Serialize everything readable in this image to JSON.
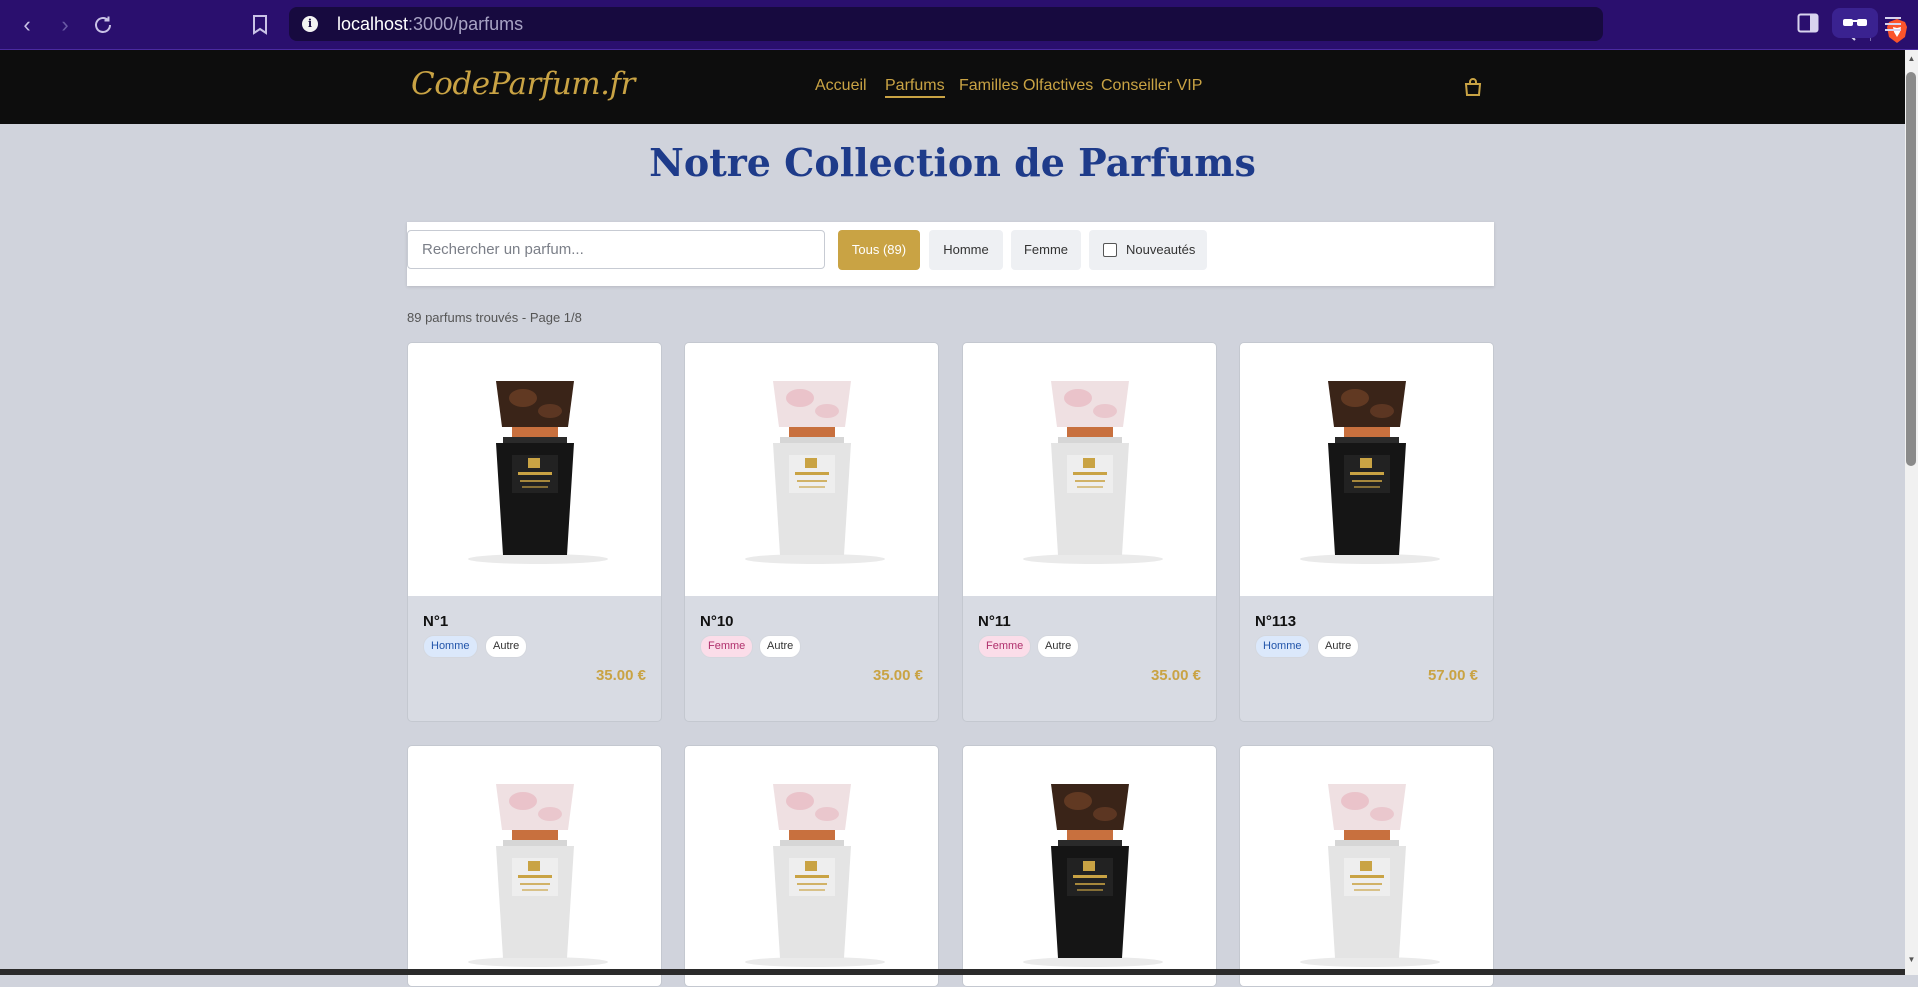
{
  "browser": {
    "url_host": "localhost",
    "url_path": ":3000/parfums",
    "info_icon": "info-icon"
  },
  "site": {
    "logo": "CodeParfum.fr",
    "nav": [
      {
        "label": "Accueil",
        "active": false
      },
      {
        "label": "Parfums",
        "active": true
      },
      {
        "label": "Familles Olfactives",
        "active": false
      },
      {
        "label": "Conseiller VIP",
        "active": false
      }
    ],
    "cart_icon": "shopping-bag-icon"
  },
  "main": {
    "title": "Notre Collection de Parfums",
    "search_placeholder": "Rechercher un parfum...",
    "filters": {
      "all": "Tous (89)",
      "homme": "Homme",
      "femme": "Femme",
      "new": "Nouveautés"
    },
    "count_text": "89 parfums trouvés - Page 1/8"
  },
  "products": [
    {
      "name": "N°1",
      "gender": "Homme",
      "family": "Autre",
      "price": "35.00 €",
      "bottle": "black"
    },
    {
      "name": "N°10",
      "gender": "Femme",
      "family": "Autre",
      "price": "35.00 €",
      "bottle": "white"
    },
    {
      "name": "N°11",
      "gender": "Femme",
      "family": "Autre",
      "price": "35.00 €",
      "bottle": "white"
    },
    {
      "name": "N°113",
      "gender": "Homme",
      "family": "Autre",
      "price": "57.00 €",
      "bottle": "black"
    },
    {
      "bottle": "white"
    },
    {
      "bottle": "white"
    },
    {
      "bottle": "black"
    },
    {
      "bottle": "white"
    }
  ],
  "colors": {
    "accent_gold": "#c9a344",
    "title_blue": "#1e3b8a",
    "browser_purple": "#2a0f6e",
    "header_black": "#0d0d0d"
  }
}
